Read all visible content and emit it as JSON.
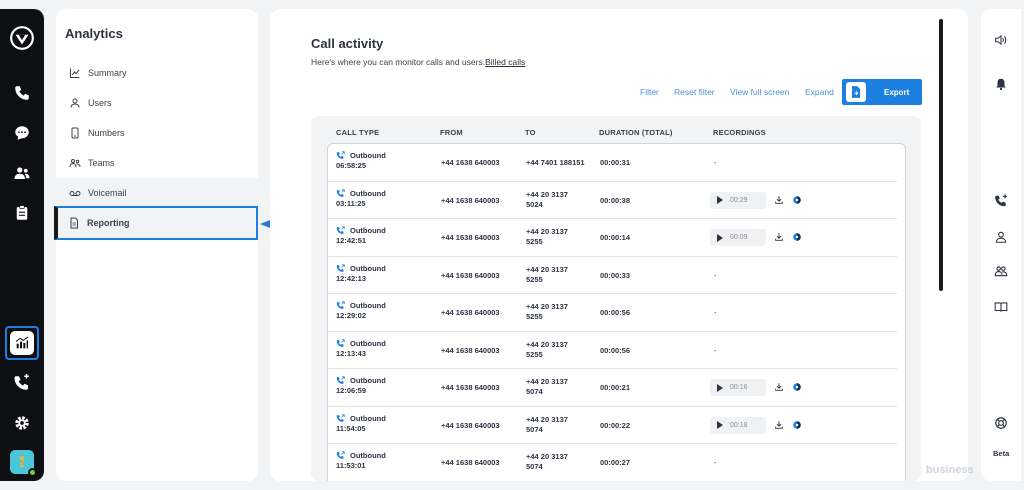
{
  "sidebar": {
    "title": "Analytics",
    "items": [
      {
        "label": "Summary",
        "icon": "chart-line-icon"
      },
      {
        "label": "Users",
        "icon": "user-icon"
      },
      {
        "label": "Numbers",
        "icon": "phone-device-icon"
      },
      {
        "label": "Teams",
        "icon": "teams-icon"
      },
      {
        "label": "Voicemail",
        "icon": "voicemail-icon"
      },
      {
        "label": "Reporting",
        "icon": "report-icon"
      }
    ]
  },
  "main": {
    "title": "Call activity",
    "subtitle": "Here's where you can monitor calls and users.",
    "subtitle_link": "Billed calls",
    "toolbar": {
      "filter": "Filter",
      "reset_filter": "Reset filter",
      "view_full_screen": "View full screen",
      "expand": "Expand",
      "export": "Export"
    },
    "table": {
      "headers": [
        "CALL TYPE",
        "FROM",
        "TO",
        "DURATION (TOTAL)",
        "RECORDINGS"
      ],
      "rows": [
        {
          "direction": "Outbound",
          "time": "06:58:25",
          "from": "+44 1638 640003",
          "to_line1": "+44 7401 188151",
          "to_line2": "",
          "duration": "00:00:31",
          "recording": "-"
        },
        {
          "direction": "Outbound",
          "time": "03:11:25",
          "from": "+44 1638 640003",
          "to_line1": "+44 20 3137",
          "to_line2": "5024",
          "duration": "00:00:38",
          "recording": "00:29"
        },
        {
          "direction": "Outbound",
          "time": "12:42:51",
          "from": "+44 1638 640003",
          "to_line1": "+44 20 3137",
          "to_line2": "5255",
          "duration": "00:00:14",
          "recording": "00:09"
        },
        {
          "direction": "Outbound",
          "time": "12:42:13",
          "from": "+44 1638 640003",
          "to_line1": "+44 20 3137",
          "to_line2": "5255",
          "duration": "00:00:33",
          "recording": "-"
        },
        {
          "direction": "Outbound",
          "time": "12:29:02",
          "from": "+44 1638 640003",
          "to_line1": "+44 20 3137",
          "to_line2": "5255",
          "duration": "00:00:56",
          "recording": "-"
        },
        {
          "direction": "Outbound",
          "time": "12:13:43",
          "from": "+44 1638 640003",
          "to_line1": "+44 20 3137",
          "to_line2": "5255",
          "duration": "00:00:56",
          "recording": "-"
        },
        {
          "direction": "Outbound",
          "time": "12:06:59",
          "from": "+44 1638 640003",
          "to_line1": "+44 20 3137",
          "to_line2": "5074",
          "duration": "00:00:21",
          "recording": "00:16"
        },
        {
          "direction": "Outbound",
          "time": "11:54:05",
          "from": "+44 1638 640003",
          "to_line1": "+44 20 3137",
          "to_line2": "5074",
          "duration": "00:00:22",
          "recording": "00:18"
        },
        {
          "direction": "Outbound",
          "time": "11:53:01",
          "from": "+44 1638 640003",
          "to_line1": "+44 20 3137",
          "to_line2": "5074",
          "duration": "00:00:27",
          "recording": "-"
        }
      ]
    }
  },
  "right_rail": {
    "beta": "Beta"
  },
  "watermark": "business",
  "colors": {
    "accent": "#1d7fe0",
    "link": "#4d8fd6",
    "rail_bg": "#0e0f12"
  }
}
